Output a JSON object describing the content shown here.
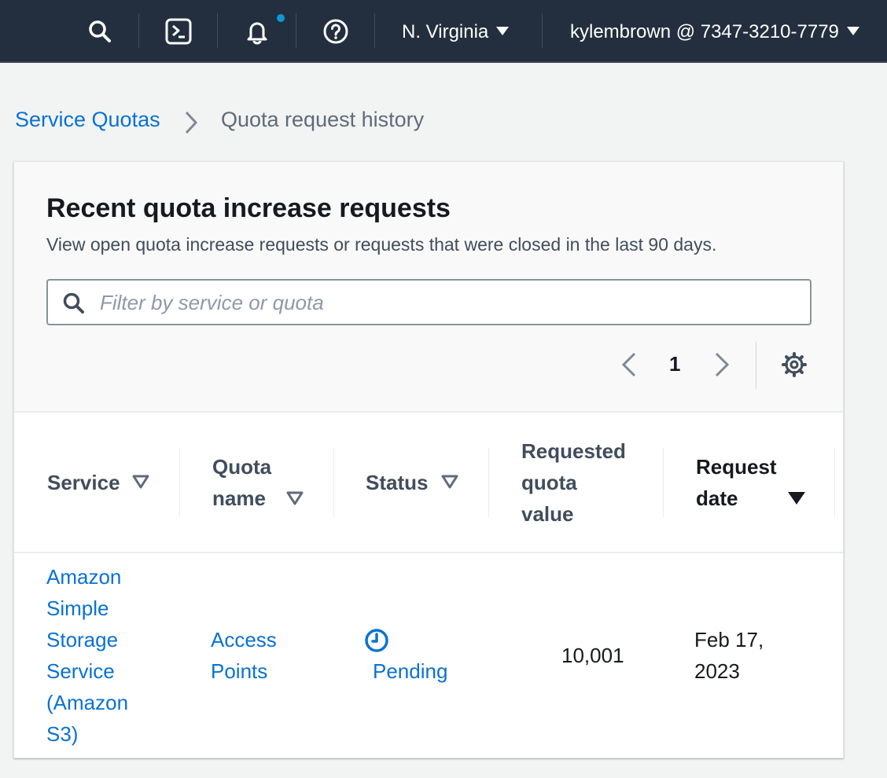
{
  "nav": {
    "region": "N. Virginia",
    "account": "kylembrown @ 7347-3210-7779",
    "icons": [
      "search-icon",
      "cloudshell-icon",
      "notifications-icon",
      "help-icon"
    ],
    "colors": {
      "background": "#232f3e",
      "notification_dot": "#0a9ad7"
    }
  },
  "breadcrumb": {
    "parent": "Service Quotas",
    "current": "Quota request history"
  },
  "panel": {
    "title": "Recent quota increase requests",
    "description": "View open quota increase requests or requests that were closed in the last 90 days.",
    "filter_placeholder": "Filter by service or quota",
    "filter_value": ""
  },
  "pagination": {
    "current_page": "1"
  },
  "table": {
    "columns": {
      "service": "Service",
      "quota_name_1": "Quota",
      "quota_name_2": "name",
      "status": "Status",
      "requested_1": "Requested",
      "requested_2": "quota",
      "requested_3": "value",
      "date_1": "Request",
      "date_2": "date"
    },
    "sorted_column": "Request date",
    "sort_direction": "descending",
    "rows": [
      {
        "service_lines": [
          "Amazon",
          "Simple",
          "Storage",
          "Service",
          "(Amazon",
          "S3)"
        ],
        "quota_lines": [
          "Access",
          "Points"
        ],
        "status": "Pending",
        "requested_value": "10,001",
        "date_lines": [
          "Feb 17,",
          "2023"
        ]
      }
    ]
  },
  "colors": {
    "link": "#0972d3",
    "page_bg": "#f2f3f3"
  }
}
